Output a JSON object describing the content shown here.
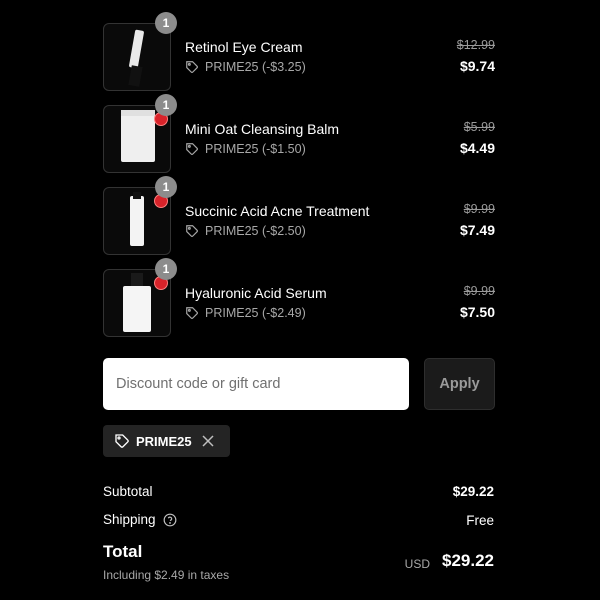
{
  "items": [
    {
      "qty": "1",
      "name": "Retinol Eye Cream",
      "discount": "PRIME25 (-$3.25)",
      "original_price": "$12.99",
      "price": "$9.74"
    },
    {
      "qty": "1",
      "name": "Mini Oat Cleansing Balm",
      "discount": "PRIME25 (-$1.50)",
      "original_price": "$5.99",
      "price": "$4.49"
    },
    {
      "qty": "1",
      "name": "Succinic Acid Acne Treatment",
      "discount": "PRIME25 (-$2.50)",
      "original_price": "$9.99",
      "price": "$7.49"
    },
    {
      "qty": "1",
      "name": "Hyaluronic Acid Serum",
      "discount": "PRIME25 (-$2.49)",
      "original_price": "$9.99",
      "price": "$7.50"
    }
  ],
  "discount_field": {
    "placeholder": "Discount code or gift card",
    "value": ""
  },
  "apply_label": "Apply",
  "applied_code": "PRIME25",
  "summary": {
    "subtotal_label": "Subtotal",
    "subtotal_value": "$29.22",
    "shipping_label": "Shipping",
    "shipping_value": "Free",
    "total_label": "Total",
    "tax_note": "Including $2.49 in taxes",
    "currency": "USD",
    "total_value": "$29.22"
  },
  "colors": {
    "background": "#000000",
    "qty_badge": "#8c8c8c",
    "chip_bg": "#242424",
    "input_bg": "#ffffff"
  },
  "icons": [
    "tag-icon",
    "close-icon",
    "help-circle-icon"
  ]
}
